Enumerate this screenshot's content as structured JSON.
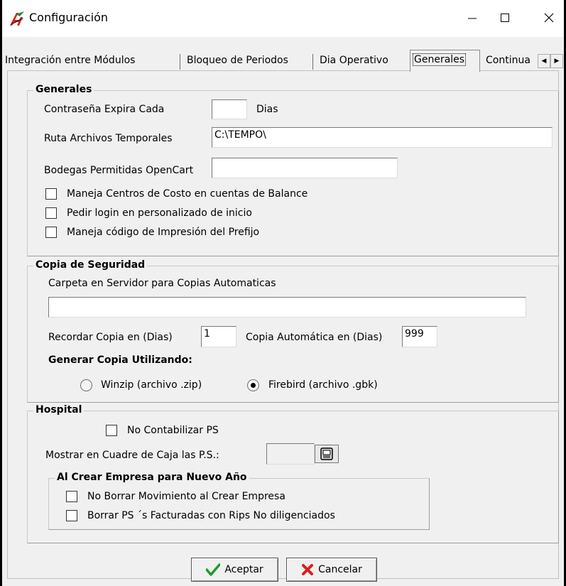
{
  "window": {
    "title": "Configuración"
  },
  "tabs": [
    {
      "label": "Integración entre Módulos"
    },
    {
      "label": "Bloqueo de Periodos"
    },
    {
      "label": "Dia Operativo"
    },
    {
      "label": "Generales"
    },
    {
      "label": "Continua"
    }
  ],
  "generales": {
    "legend": "Generales",
    "password_label": "Contraseña Expira Cada",
    "password_value": "",
    "password_unit": "Dias",
    "temp_path_label": "Ruta Archivos Temporales",
    "temp_path_value": "C:\\TEMPO\\",
    "opencart_label": "Bodegas Permitidas OpenCart",
    "opencart_value": "",
    "checkboxes": [
      {
        "label": "Maneja Centros de Costo en cuentas de Balance",
        "checked": false
      },
      {
        "label": "Pedir login en personalizado de inicio",
        "checked": false
      },
      {
        "label": "Maneja código de Impresión del Prefijo",
        "checked": false
      }
    ]
  },
  "backup": {
    "legend": "Copia de Seguridad",
    "folder_label": "Carpeta en Servidor para Copias Automaticas",
    "folder_value": "",
    "remind_label": "Recordar Copia en (Dias)",
    "remind_value": "1",
    "auto_label": "Copia Automática en (Dias)",
    "auto_value": "999",
    "method_label": "Generar Copia Utilizando:",
    "options": [
      {
        "label": "Winzip (archivo .zip)",
        "selected": false
      },
      {
        "label": "Firebird (archivo .gbk)",
        "selected": true
      }
    ]
  },
  "hospital": {
    "legend": "Hospital",
    "no_post_label": "No Contabilizar PS",
    "no_post_checked": false,
    "cash_label": "Mostrar en Cuadre de Caja las P.S.:",
    "cash_value": "",
    "new_year": {
      "legend": "Al Crear Empresa para Nuevo Año",
      "checkboxes": [
        {
          "label": "No Borrar Movimiento al Crear Empresa",
          "checked": false
        },
        {
          "label": "Borrar PS ´s Facturadas con Rips No diligenciados",
          "checked": false
        }
      ]
    }
  },
  "buttons": {
    "accept": "Aceptar",
    "cancel": "Cancelar"
  }
}
